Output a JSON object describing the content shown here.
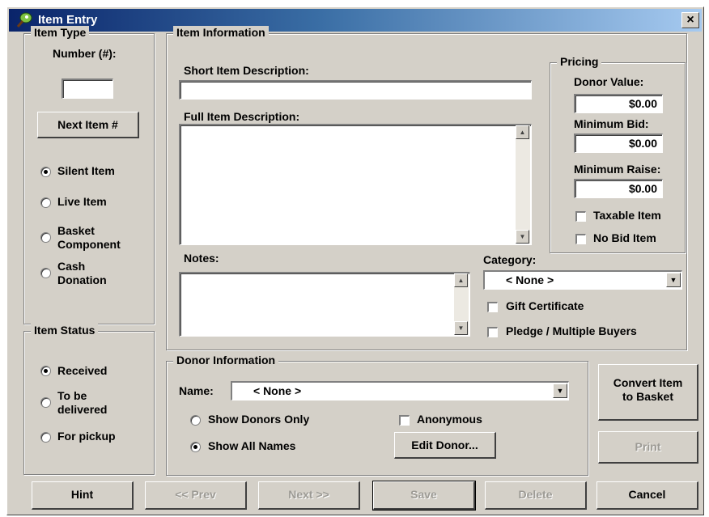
{
  "window": {
    "title": "Item Entry",
    "close_glyph": "×",
    "icon": "auction-paddle-icon"
  },
  "item_type": {
    "legend": "Item Type",
    "number_label": "Number (#):",
    "number_value": "",
    "next_item_button": "Next Item #",
    "options": [
      {
        "label": "Silent Item",
        "selected": true
      },
      {
        "label": "Live Item",
        "selected": false
      },
      {
        "label": "Basket Component",
        "selected": false
      },
      {
        "label": "Cash Donation",
        "selected": false
      }
    ]
  },
  "item_status": {
    "legend": "Item Status",
    "options": [
      {
        "label": "Received",
        "selected": true
      },
      {
        "label": "To be delivered",
        "selected": false
      },
      {
        "label": "For pickup",
        "selected": false
      }
    ]
  },
  "item_info": {
    "legend": "Item Information",
    "short_desc_label": "Short Item Description:",
    "short_desc_value": "",
    "full_desc_label": "Full Item Description:",
    "full_desc_value": "",
    "notes_label": "Notes:",
    "notes_value": "",
    "category_label": "Category:",
    "category_value": "< None >",
    "gift_certificate_label": "Gift Certificate",
    "pledge_label": "Pledge / Multiple Buyers"
  },
  "pricing": {
    "legend": "Pricing",
    "donor_value_label": "Donor Value:",
    "donor_value": "$0.00",
    "min_bid_label": "Minimum Bid:",
    "min_bid": "$0.00",
    "min_raise_label": "Minimum Raise:",
    "min_raise": "$0.00",
    "taxable_label": "Taxable Item",
    "no_bid_label": "No Bid Item"
  },
  "donor_info": {
    "legend": "Donor Information",
    "name_label": "Name:",
    "name_value": "< None >",
    "show_donors_only": "Show Donors Only",
    "show_all_names": "Show All Names",
    "anonymous_label": "Anonymous",
    "edit_donor_button": "Edit Donor..."
  },
  "side_buttons": {
    "convert_line1": "Convert Item",
    "convert_line2": "to Basket",
    "print": "Print"
  },
  "bottom_buttons": {
    "hint": "Hint",
    "prev": "<< Prev",
    "next": "Next >>",
    "save": "Save",
    "delete": "Delete",
    "cancel": "Cancel"
  }
}
